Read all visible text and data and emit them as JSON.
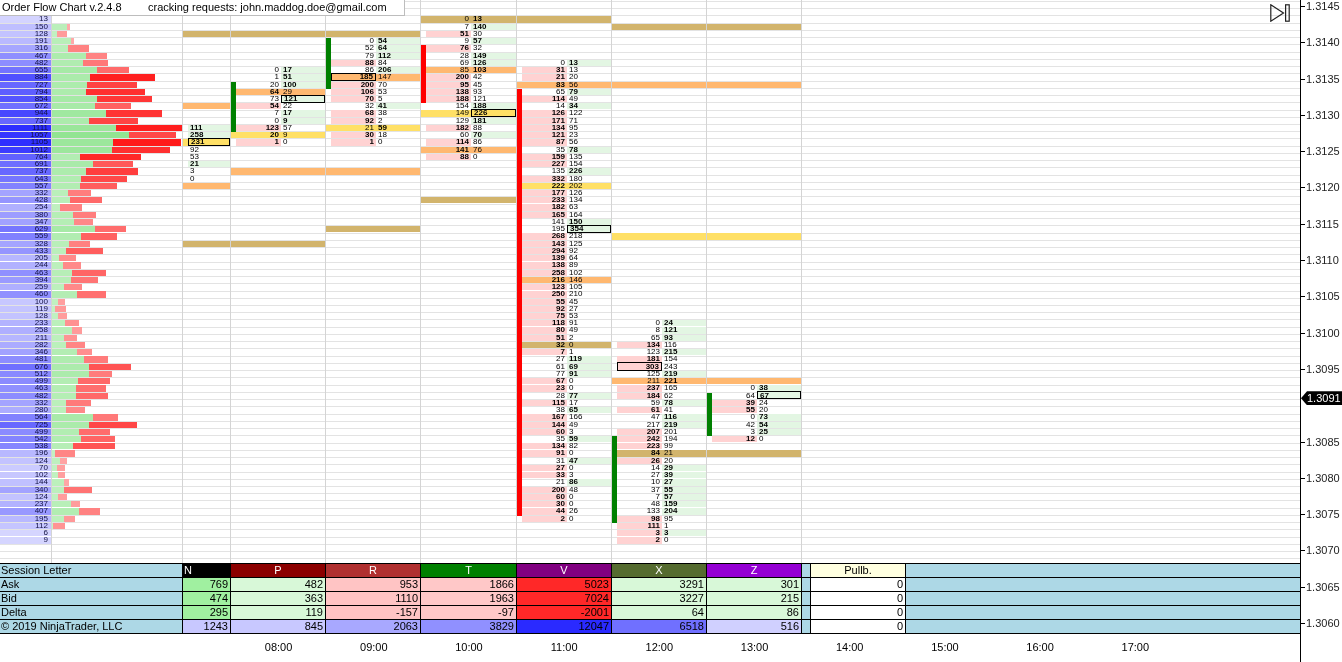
{
  "header": {
    "title": "Order Flow Chart v.2.4.8",
    "note": "cracking requests: john.maddog.doe@gmail.com"
  },
  "profile": [
    {
      "volume": "13"
    },
    {
      "volume": "150",
      "level": 0.87
    },
    {
      "volume": "128",
      "level": 0.35
    },
    {
      "volume": "191",
      "level": 0.85
    },
    {
      "volume": "316",
      "level": 0.44
    },
    {
      "volume": "467",
      "level": 0.63
    },
    {
      "volume": "482",
      "level": 0.55
    },
    {
      "volume": "655",
      "level": 0.59
    },
    {
      "volume": "884",
      "level": 0.37
    },
    {
      "volume": "727",
      "level": 0.41
    },
    {
      "volume": "794",
      "level": 0.37
    },
    {
      "volume": "854",
      "level": 0.45
    },
    {
      "volume": "672",
      "level": 0.55
    },
    {
      "volume": "944",
      "level": 0.49
    },
    {
      "volume": "737",
      "level": 0.43
    },
    {
      "volume": "1111",
      "level": 0.49
    },
    {
      "volume": "1057",
      "level": 0.62
    },
    {
      "volume": "1105",
      "level": 0.47
    },
    {
      "volume": "1012",
      "level": 0.51
    },
    {
      "volume": "764",
      "level": 0.31
    },
    {
      "volume": "691",
      "level": 0.51
    },
    {
      "volume": "737",
      "level": 0.4
    },
    {
      "volume": "643",
      "level": 0.38
    },
    {
      "volume": "557",
      "level": 0.43
    },
    {
      "volume": "332",
      "level": 0.4
    },
    {
      "volume": "428",
      "level": 0.36
    },
    {
      "volume": "254",
      "level": 0.28
    },
    {
      "volume": "380",
      "level": 0.48
    },
    {
      "volume": "347",
      "level": 0.55
    },
    {
      "volume": "629",
      "level": 0.59
    },
    {
      "volume": "559",
      "level": 0.45
    },
    {
      "volume": "328",
      "level": 0.43
    },
    {
      "volume": "433",
      "level": 0.27
    },
    {
      "volume": "205",
      "level": 0.31
    },
    {
      "volume": "244",
      "level": 0.4
    },
    {
      "volume": "463",
      "level": 0.37
    },
    {
      "volume": "394",
      "level": 0.42
    },
    {
      "volume": "259",
      "level": 0.41
    },
    {
      "volume": "460",
      "level": 0.46
    },
    {
      "volume": "100",
      "level": 0.43
    },
    {
      "volume": "119",
      "level": 0.24
    },
    {
      "volume": "128",
      "level": 0.42
    },
    {
      "volume": "233",
      "level": 0.49
    },
    {
      "volume": "258",
      "level": 0.67
    },
    {
      "volume": "211",
      "level": 0.47
    },
    {
      "volume": "282",
      "level": 0.41
    },
    {
      "volume": "346",
      "level": 0.63
    },
    {
      "volume": "481",
      "level": 0.57
    },
    {
      "volume": "676",
      "level": 0.47
    },
    {
      "volume": "512",
      "level": 0.61
    },
    {
      "volume": "499",
      "level": 0.45
    },
    {
      "volume": "463",
      "level": 0.45
    },
    {
      "volume": "482",
      "level": 0.43
    },
    {
      "volume": "332",
      "level": 0.37
    },
    {
      "volume": "280",
      "level": 0.44
    },
    {
      "volume": "564",
      "level": 0.62
    },
    {
      "volume": "725",
      "level": 0.44
    },
    {
      "volume": "499",
      "level": 0.47
    },
    {
      "volume": "542",
      "level": 0.46
    },
    {
      "volume": "538",
      "level": 0.34
    },
    {
      "volume": "196",
      "level": 0.15
    },
    {
      "volume": "124",
      "level": 0.58
    },
    {
      "volume": "70",
      "level": 0.4
    },
    {
      "volume": "102",
      "level": 0.43
    },
    {
      "volume": "144",
      "level": 0.72
    },
    {
      "volume": "340",
      "level": 0.31
    },
    {
      "volume": "124",
      "level": 0.42
    },
    {
      "volume": "237",
      "level": 0.67
    },
    {
      "volume": "407",
      "level": 0.56
    },
    {
      "volume": "195",
      "level": 0.52
    },
    {
      "volume": "112",
      "level": 0.03
    },
    {
      "volume": "6"
    },
    {
      "volume": "9"
    }
  ],
  "footprint": [
    {
      "cells": [
        null,
        null,
        {
          "color": "#d2b46c"
        },
        null,
        null,
        null,
        null,
        null,
        null,
        null,
        null,
        null,
        {
          "color": "#ffb870"
        },
        null,
        null,
        {
          "ask": "111",
          "ask_bold": true,
          "ask_box": false,
          "body": false
        },
        {
          "ask": "258",
          "ask_bold": true,
          "ask_box": false,
          "body": false
        },
        {
          "ask": "231",
          "ask_bold": true,
          "ask_box": true,
          "body": false,
          "color": "#ffe066"
        },
        {
          "ask": "92",
          "ask_bold": false,
          "ask_box": false,
          "body": false
        },
        {
          "ask": "53",
          "ask_bold": false,
          "ask_box": false,
          "body": false
        },
        {
          "ask": "21",
          "ask_bold": true,
          "ask_box": false,
          "body": false
        },
        {
          "ask": "3",
          "ask_bold": false,
          "ask_box": false,
          "body": false
        },
        {
          "ask": "0",
          "ask_bold": false,
          "ask_box": false,
          "body": false
        },
        {
          "color": "#ffb870"
        },
        null,
        null,
        null,
        null,
        null,
        null,
        null,
        {
          "color": "#d2b46c"
        }
      ]
    },
    {
      "rising": true,
      "cells": [
        null,
        null,
        {
          "color": "#d2b46c"
        },
        null,
        null,
        null,
        null,
        {
          "bid": "0",
          "ask": "17",
          "bid_box": false,
          "ask_box": false,
          "body": false
        },
        {
          "bid": "1",
          "ask": "51",
          "bid_box": false,
          "ask_box": false,
          "body": false
        },
        {
          "bid": "20",
          "ask": "100",
          "bid_box": false,
          "ask_box": false,
          "body": true
        },
        {
          "bid": "64",
          "ask": "29",
          "bid_box": false,
          "ask_box": false,
          "body": true,
          "color": "#ffb870"
        },
        {
          "bid": "73",
          "ask": "121",
          "bid_box": false,
          "ask_box": true,
          "body": true
        },
        {
          "bid": "54",
          "ask": "22",
          "bid_box": false,
          "ask_box": false,
          "body": true
        },
        {
          "bid": "7",
          "ask": "17",
          "bid_box": false,
          "ask_box": false,
          "body": true
        },
        {
          "bid": "0",
          "ask": "9",
          "bid_box": false,
          "ask_box": false,
          "body": true
        },
        {
          "bid": "123",
          "ask": "57",
          "bid_box": false,
          "ask_box": false,
          "body": true
        },
        {
          "bid": "20",
          "ask": "9",
          "bid_box": false,
          "ask_box": false,
          "body": false,
          "color": "#ffe066"
        },
        {
          "bid": "1",
          "ask": "0",
          "bid_box": false,
          "ask_box": false,
          "body": false
        },
        null,
        null,
        null,
        {
          "color": "#ffb870"
        },
        null,
        null,
        null,
        null,
        null,
        null,
        null,
        null,
        null,
        {
          "color": "#d2b46c"
        }
      ]
    },
    {
      "rising": true,
      "cells": [
        null,
        null,
        {
          "color": "#d2b46c"
        },
        {
          "bid": "0",
          "ask": "54",
          "bid_box": false,
          "ask_box": false,
          "body": true
        },
        {
          "bid": "52",
          "ask": "64",
          "bid_box": false,
          "ask_box": false,
          "body": true
        },
        {
          "bid": "79",
          "ask": "112",
          "bid_box": false,
          "ask_box": false,
          "body": true
        },
        {
          "bid": "88",
          "ask": "84",
          "bid_box": false,
          "ask_box": false,
          "body": true
        },
        {
          "bid": "86",
          "ask": "206",
          "bid_box": false,
          "ask_box": false,
          "body": true
        },
        {
          "bid": "185",
          "ask": "147",
          "bid_box": true,
          "ask_box": false,
          "body": true,
          "color": "#ffb870"
        },
        {
          "bid": "200",
          "ask": "70",
          "bid_box": false,
          "ask_box": false,
          "body": true
        },
        {
          "bid": "106",
          "ask": "53",
          "bid_box": false,
          "ask_box": false,
          "body": false
        },
        {
          "bid": "70",
          "ask": "5",
          "bid_box": false,
          "ask_box": false,
          "body": false
        },
        {
          "bid": "32",
          "ask": "41",
          "bid_box": false,
          "ask_box": false,
          "body": false
        },
        {
          "bid": "68",
          "ask": "38",
          "bid_box": false,
          "ask_box": false,
          "body": false
        },
        {
          "bid": "92",
          "ask": "2",
          "bid_box": false,
          "ask_box": false,
          "body": false
        },
        {
          "bid": "21",
          "ask": "59",
          "bid_box": false,
          "ask_box": false,
          "body": false,
          "color": "#ffe066"
        },
        {
          "bid": "30",
          "ask": "18",
          "bid_box": false,
          "ask_box": false,
          "body": false
        },
        {
          "bid": "1",
          "ask": "0",
          "bid_box": false,
          "ask_box": false,
          "body": false
        },
        null,
        null,
        null,
        {
          "color": "#ffb870"
        },
        null,
        null,
        null,
        null,
        null,
        null,
        null,
        {
          "color": "#d2b46c"
        }
      ]
    },
    {
      "rising": false,
      "cells": [
        {
          "bid": "0",
          "ask": "13",
          "bid_box": false,
          "ask_box": false,
          "body": false,
          "color": "#d2b46c"
        },
        {
          "bid": "7",
          "ask": "140",
          "bid_box": false,
          "ask_box": false,
          "body": false
        },
        {
          "bid": "51",
          "ask": "30",
          "bid_box": false,
          "ask_box": false,
          "body": false
        },
        {
          "bid": "9",
          "ask": "57",
          "bid_box": false,
          "ask_box": false,
          "body": false
        },
        {
          "bid": "76",
          "ask": "32",
          "bid_box": false,
          "ask_box": false,
          "body": true
        },
        {
          "bid": "28",
          "ask": "149",
          "bid_box": false,
          "ask_box": false,
          "body": true
        },
        {
          "bid": "69",
          "ask": "126",
          "bid_box": false,
          "ask_box": false,
          "body": true
        },
        {
          "bid": "85",
          "ask": "103",
          "bid_box": false,
          "ask_box": false,
          "body": true,
          "color": "#ffb870"
        },
        {
          "bid": "200",
          "ask": "42",
          "bid_box": false,
          "ask_box": false,
          "body": true
        },
        {
          "bid": "95",
          "ask": "45",
          "bid_box": false,
          "ask_box": false,
          "body": true
        },
        {
          "bid": "138",
          "ask": "93",
          "bid_box": false,
          "ask_box": false,
          "body": true
        },
        {
          "bid": "188",
          "ask": "121",
          "bid_box": false,
          "ask_box": false,
          "body": true
        },
        {
          "bid": "154",
          "ask": "188",
          "bid_box": false,
          "ask_box": false,
          "body": false
        },
        {
          "bid": "149",
          "ask": "226",
          "bid_box": false,
          "ask_box": true,
          "body": false,
          "color": "#ffe066"
        },
        {
          "bid": "129",
          "ask": "181",
          "bid_box": false,
          "ask_box": false,
          "body": false
        },
        {
          "bid": "182",
          "ask": "88",
          "bid_box": false,
          "ask_box": false,
          "body": false
        },
        {
          "bid": "60",
          "ask": "70",
          "bid_box": false,
          "ask_box": false,
          "body": false
        },
        {
          "bid": "114",
          "ask": "86",
          "bid_box": false,
          "ask_box": false,
          "body": false
        },
        {
          "bid": "141",
          "ask": "76",
          "bid_box": false,
          "ask_box": false,
          "body": false,
          "color": "#ffb870"
        },
        {
          "bid": "88",
          "ask": "0",
          "bid_box": false,
          "ask_box": false,
          "body": false
        },
        null,
        null,
        null,
        null,
        null,
        {
          "color": "#d2b46c"
        }
      ]
    },
    {
      "rising": false,
      "cells": [
        {
          "color": "#d2b46c"
        },
        null,
        null,
        null,
        null,
        null,
        {
          "bid": "0",
          "ask": "13",
          "bid_box": false,
          "ask_box": false,
          "body": false
        },
        {
          "bid": "31",
          "ask": "13",
          "bid_box": false,
          "ask_box": false,
          "body": false
        },
        {
          "bid": "21",
          "ask": "20",
          "bid_box": false,
          "ask_box": false,
          "body": false
        },
        {
          "bid": "83",
          "ask": "56",
          "bid_box": false,
          "ask_box": false,
          "body": false,
          "color": "#ffb870"
        },
        {
          "bid": "65",
          "ask": "79",
          "bid_box": false,
          "ask_box": false,
          "body": true
        },
        {
          "bid": "114",
          "ask": "49",
          "bid_box": false,
          "ask_box": false,
          "body": true
        },
        {
          "bid": "14",
          "ask": "34",
          "bid_box": false,
          "ask_box": false,
          "body": true
        },
        {
          "bid": "126",
          "ask": "122",
          "bid_box": false,
          "ask_box": false,
          "body": true
        },
        {
          "bid": "171",
          "ask": "71",
          "bid_box": false,
          "ask_box": false,
          "body": true
        },
        {
          "bid": "134",
          "ask": "95",
          "bid_box": false,
          "ask_box": false,
          "body": true
        },
        {
          "bid": "121",
          "ask": "23",
          "bid_box": false,
          "ask_box": false,
          "body": true
        },
        {
          "bid": "87",
          "ask": "56",
          "bid_box": false,
          "ask_box": false,
          "body": true
        },
        {
          "bid": "35",
          "ask": "78",
          "bid_box": false,
          "ask_box": false,
          "body": true
        },
        {
          "bid": "159",
          "ask": "135",
          "bid_box": false,
          "ask_box": false,
          "body": true
        },
        {
          "bid": "227",
          "ask": "154",
          "bid_box": false,
          "ask_box": false,
          "body": true
        },
        {
          "bid": "135",
          "ask": "226",
          "bid_box": false,
          "ask_box": false,
          "body": true
        },
        {
          "bid": "332",
          "ask": "180",
          "bid_box": false,
          "ask_box": false,
          "body": true
        },
        {
          "bid": "222",
          "ask": "202",
          "bid_box": false,
          "ask_box": false,
          "body": true,
          "color": "#ffe066"
        },
        {
          "bid": "177",
          "ask": "126",
          "bid_box": false,
          "ask_box": false,
          "body": true
        },
        {
          "bid": "233",
          "ask": "134",
          "bid_box": false,
          "ask_box": false,
          "body": true
        },
        {
          "bid": "182",
          "ask": "63",
          "bid_box": false,
          "ask_box": false,
          "body": true
        },
        {
          "bid": "165",
          "ask": "164",
          "bid_box": false,
          "ask_box": false,
          "body": true
        },
        {
          "bid": "141",
          "ask": "150",
          "bid_box": false,
          "ask_box": false,
          "body": true
        },
        {
          "bid": "195",
          "ask": "354",
          "bid_box": false,
          "ask_box": true,
          "body": true
        },
        {
          "bid": "268",
          "ask": "218",
          "bid_box": false,
          "ask_box": false,
          "body": true
        },
        {
          "bid": "143",
          "ask": "125",
          "bid_box": false,
          "ask_box": false,
          "body": true
        },
        {
          "bid": "294",
          "ask": "92",
          "bid_box": false,
          "ask_box": false,
          "body": true
        },
        {
          "bid": "139",
          "ask": "64",
          "bid_box": false,
          "ask_box": false,
          "body": true
        },
        {
          "bid": "138",
          "ask": "89",
          "bid_box": false,
          "ask_box": false,
          "body": true
        },
        {
          "bid": "258",
          "ask": "102",
          "bid_box": false,
          "ask_box": false,
          "body": true
        },
        {
          "bid": "216",
          "ask": "146",
          "bid_box": false,
          "ask_box": false,
          "body": true,
          "color": "#ffb870"
        },
        {
          "bid": "123",
          "ask": "105",
          "bid_box": false,
          "ask_box": false,
          "body": true
        },
        {
          "bid": "250",
          "ask": "210",
          "bid_box": false,
          "ask_box": false,
          "body": true
        },
        {
          "bid": "55",
          "ask": "45",
          "bid_box": false,
          "ask_box": false,
          "body": true
        },
        {
          "bid": "92",
          "ask": "27",
          "bid_box": false,
          "ask_box": false,
          "body": true
        },
        {
          "bid": "75",
          "ask": "53",
          "bid_box": false,
          "ask_box": false,
          "body": true
        },
        {
          "bid": "118",
          "ask": "91",
          "bid_box": false,
          "ask_box": false,
          "body": true
        },
        {
          "bid": "80",
          "ask": "49",
          "bid_box": false,
          "ask_box": false,
          "body": true
        },
        {
          "bid": "51",
          "ask": "2",
          "bid_box": false,
          "ask_box": false,
          "body": true
        },
        {
          "bid": "32",
          "ask": "0",
          "bid_box": false,
          "ask_box": false,
          "body": true,
          "color": "#d2b46c"
        },
        {
          "bid": "7",
          "ask": "1",
          "bid_box": false,
          "ask_box": false,
          "body": true
        },
        {
          "bid": "27",
          "ask": "119",
          "bid_box": false,
          "ask_box": false,
          "body": true
        },
        {
          "bid": "61",
          "ask": "69",
          "bid_box": false,
          "ask_box": false,
          "body": true
        },
        {
          "bid": "77",
          "ask": "91",
          "bid_box": false,
          "ask_box": false,
          "body": true
        },
        {
          "bid": "67",
          "ask": "0",
          "bid_box": false,
          "ask_box": false,
          "body": true
        },
        {
          "bid": "23",
          "ask": "0",
          "bid_box": false,
          "ask_box": false,
          "body": true
        },
        {
          "bid": "28",
          "ask": "77",
          "bid_box": false,
          "ask_box": false,
          "body": true
        },
        {
          "bid": "115",
          "ask": "17",
          "bid_box": false,
          "ask_box": false,
          "body": true
        },
        {
          "bid": "38",
          "ask": "65",
          "bid_box": false,
          "ask_box": false,
          "body": true
        },
        {
          "bid": "167",
          "ask": "166",
          "bid_box": false,
          "ask_box": false,
          "body": true
        },
        {
          "bid": "144",
          "ask": "49",
          "bid_box": false,
          "ask_box": false,
          "body": true
        },
        {
          "bid": "60",
          "ask": "3",
          "bid_box": false,
          "ask_box": false,
          "body": true
        },
        {
          "bid": "35",
          "ask": "59",
          "bid_box": false,
          "ask_box": false,
          "body": true
        },
        {
          "bid": "134",
          "ask": "82",
          "bid_box": false,
          "ask_box": false,
          "body": true
        },
        {
          "bid": "91",
          "ask": "0",
          "bid_box": false,
          "ask_box": false,
          "body": true
        },
        {
          "bid": "31",
          "ask": "47",
          "bid_box": false,
          "ask_box": false,
          "body": true
        },
        {
          "bid": "27",
          "ask": "0",
          "bid_box": false,
          "ask_box": false,
          "body": true
        },
        {
          "bid": "33",
          "ask": "3",
          "bid_box": false,
          "ask_box": false,
          "body": true
        },
        {
          "bid": "21",
          "ask": "86",
          "bid_box": false,
          "ask_box": false,
          "body": true
        },
        {
          "bid": "200",
          "ask": "48",
          "bid_box": false,
          "ask_box": false,
          "body": true
        },
        {
          "bid": "60",
          "ask": "0",
          "bid_box": false,
          "ask_box": false,
          "body": true
        },
        {
          "bid": "30",
          "ask": "0",
          "bid_box": false,
          "ask_box": false,
          "body": true
        },
        {
          "bid": "44",
          "ask": "26",
          "bid_box": false,
          "ask_box": false,
          "body": true
        },
        {
          "bid": "2",
          "ask": "0",
          "bid_box": false,
          "ask_box": false,
          "body": false
        }
      ]
    },
    {
      "rising": true,
      "cells": [
        null,
        {
          "color": "#d2b46c"
        },
        null,
        null,
        null,
        null,
        null,
        null,
        null,
        {
          "color": "#ffb870"
        },
        null,
        null,
        null,
        null,
        null,
        null,
        null,
        null,
        null,
        null,
        null,
        null,
        null,
        null,
        null,
        null,
        null,
        null,
        null,
        null,
        {
          "color": "#ffe066"
        },
        null,
        null,
        null,
        null,
        null,
        null,
        null,
        null,
        null,
        null,
        null,
        {
          "bid": "0",
          "ask": "24",
          "bid_box": false,
          "ask_box": false,
          "body": false
        },
        {
          "bid": "8",
          "ask": "121",
          "bid_box": false,
          "ask_box": false,
          "body": false
        },
        {
          "bid": "65",
          "ask": "93",
          "bid_box": false,
          "ask_box": false,
          "body": false
        },
        {
          "bid": "134",
          "ask": "116",
          "bid_box": false,
          "ask_box": false,
          "body": false
        },
        {
          "bid": "123",
          "ask": "215",
          "bid_box": false,
          "ask_box": false,
          "body": false
        },
        {
          "bid": "181",
          "ask": "154",
          "bid_box": false,
          "ask_box": false,
          "body": false
        },
        {
          "bid": "303",
          "ask": "243",
          "bid_box": true,
          "ask_box": false,
          "body": false
        },
        {
          "bid": "125",
          "ask": "219",
          "bid_box": false,
          "ask_box": false,
          "body": false
        },
        {
          "bid": "211",
          "ask": "221",
          "bid_box": false,
          "ask_box": false,
          "body": false,
          "color": "#ffb870"
        },
        {
          "bid": "237",
          "ask": "165",
          "bid_box": false,
          "ask_box": false,
          "body": false
        },
        {
          "bid": "184",
          "ask": "62",
          "bid_box": false,
          "ask_box": false,
          "body": false
        },
        {
          "bid": "59",
          "ask": "78",
          "bid_box": false,
          "ask_box": false,
          "body": false
        },
        {
          "bid": "61",
          "ask": "41",
          "bid_box": false,
          "ask_box": false,
          "body": false
        },
        {
          "bid": "47",
          "ask": "116",
          "bid_box": false,
          "ask_box": false,
          "body": false
        },
        {
          "bid": "217",
          "ask": "219",
          "bid_box": false,
          "ask_box": false,
          "body": false
        },
        {
          "bid": "207",
          "ask": "201",
          "bid_box": false,
          "ask_box": false,
          "body": false
        },
        {
          "bid": "242",
          "ask": "194",
          "bid_box": false,
          "ask_box": false,
          "body": true
        },
        {
          "bid": "223",
          "ask": "99",
          "bid_box": false,
          "ask_box": false,
          "body": true
        },
        {
          "bid": "84",
          "ask": "21",
          "bid_box": false,
          "ask_box": false,
          "body": true,
          "color": "#d2b46c"
        },
        {
          "bid": "26",
          "ask": "20",
          "bid_box": false,
          "ask_box": false,
          "body": true
        },
        {
          "bid": "14",
          "ask": "29",
          "bid_box": false,
          "ask_box": false,
          "body": true
        },
        {
          "bid": "27",
          "ask": "39",
          "bid_box": false,
          "ask_box": false,
          "body": true
        },
        {
          "bid": "10",
          "ask": "27",
          "bid_box": false,
          "ask_box": false,
          "body": true
        },
        {
          "bid": "37",
          "ask": "55",
          "bid_box": false,
          "ask_box": false,
          "body": true
        },
        {
          "bid": "7",
          "ask": "57",
          "bid_box": false,
          "ask_box": false,
          "body": true
        },
        {
          "bid": "48",
          "ask": "159",
          "bid_box": false,
          "ask_box": false,
          "body": true
        },
        {
          "bid": "133",
          "ask": "204",
          "bid_box": false,
          "ask_box": false,
          "body": true
        },
        {
          "bid": "98",
          "ask": "95",
          "bid_box": false,
          "ask_box": false,
          "body": true
        },
        {
          "bid": "111",
          "ask": "1",
          "bid_box": false,
          "ask_box": false,
          "body": false
        },
        {
          "bid": "3",
          "ask": "3",
          "bid_box": false,
          "ask_box": false,
          "body": false
        },
        {
          "bid": "2",
          "ask": "0",
          "bid_box": false,
          "ask_box": false,
          "body": false
        }
      ]
    },
    {
      "rising": true,
      "cells": [
        null,
        {
          "color": "#d2b46c"
        },
        null,
        null,
        null,
        null,
        null,
        null,
        null,
        {
          "color": "#ffb870"
        },
        null,
        null,
        null,
        null,
        null,
        null,
        null,
        null,
        null,
        null,
        null,
        null,
        null,
        null,
        null,
        null,
        null,
        null,
        null,
        null,
        {
          "color": "#ffe066"
        },
        null,
        null,
        null,
        null,
        null,
        null,
        null,
        null,
        null,
        null,
        null,
        null,
        null,
        null,
        null,
        null,
        null,
        null,
        null,
        {
          "color": "#ffb870"
        },
        {
          "bid": "0",
          "ask": "38",
          "bid_box": false,
          "ask_box": false,
          "body": false
        },
        {
          "bid": "64",
          "ask": "67",
          "bid_box": false,
          "ask_box": true,
          "body": true
        },
        {
          "bid": "39",
          "ask": "24",
          "bid_box": false,
          "ask_box": false,
          "body": true
        },
        {
          "bid": "55",
          "ask": "20",
          "bid_box": false,
          "ask_box": false,
          "body": true
        },
        {
          "bid": "0",
          "ask": "73",
          "bid_box": false,
          "ask_box": false,
          "body": true
        },
        {
          "bid": "42",
          "ask": "54",
          "bid_box": false,
          "ask_box": false,
          "body": true
        },
        {
          "bid": "3",
          "ask": "25",
          "bid_box": false,
          "ask_box": false,
          "body": true
        },
        {
          "bid": "12",
          "ask": "0",
          "bid_box": false,
          "ask_box": false,
          "body": false
        },
        null,
        {
          "color": "#d2b46c"
        }
      ]
    }
  ],
  "price_axis": [
    {
      "text": "1.3145",
      "kind": "price"
    },
    {
      "text": "1.3140",
      "kind": "price"
    },
    {
      "text": "1.3135",
      "kind": "price"
    },
    {
      "text": "1.3130",
      "kind": "price"
    },
    {
      "text": "1.3125",
      "kind": "price"
    },
    {
      "text": "1.3120",
      "kind": "price"
    },
    {
      "text": "1.3115",
      "kind": "price"
    },
    {
      "text": "1.3110",
      "kind": "price"
    },
    {
      "text": "1.3105",
      "kind": "price"
    },
    {
      "text": "1.3100",
      "kind": "price"
    },
    {
      "text": "1.3095",
      "kind": "price"
    },
    {
      "text": "1.3091",
      "kind": "current"
    },
    {
      "text": "1.3085",
      "kind": "price"
    },
    {
      "text": "1.3080",
      "kind": "price"
    },
    {
      "text": "1.3075",
      "kind": "price"
    },
    {
      "text": "1.3070",
      "kind": "price"
    },
    {
      "text": "1.3065",
      "kind": "price"
    },
    {
      "text": "1.3060",
      "kind": "price"
    }
  ],
  "session_table": {
    "rows": [
      {
        "label": "Session Letter",
        "cells": [
          {
            "text": "N",
            "color": "#000000"
          },
          {
            "text": "P",
            "color": "#8b0000"
          },
          {
            "text": "R",
            "color": "#b03030"
          },
          {
            "text": "T",
            "color": "#008000"
          },
          {
            "text": "V",
            "color": "#800080"
          },
          {
            "text": "X",
            "color": "#556b2f"
          },
          {
            "text": "Z",
            "color": "#9400d3"
          }
        ],
        "pullback": "Pullb."
      },
      {
        "label": "Ask",
        "cells": [
          {
            "text": "769",
            "color": "#a0f0a0"
          },
          {
            "text": "482",
            "color": "#d8f8d8"
          },
          {
            "text": "953",
            "color": "#ffc4c4"
          },
          {
            "text": "1866",
            "color": "#ffc8c8"
          },
          {
            "text": "5023",
            "color": "#ff2828"
          },
          {
            "text": "3291",
            "color": "#d8f8d8"
          },
          {
            "text": "301",
            "color": "#d8f8d8"
          }
        ],
        "pullback": "0"
      },
      {
        "label": "Bid",
        "cells": [
          {
            "text": "474",
            "color": "#a0f0a0"
          },
          {
            "text": "363",
            "color": "#d8f8d8"
          },
          {
            "text": "1110",
            "color": "#ffc4c4"
          },
          {
            "text": "1963",
            "color": "#ffc8c8"
          },
          {
            "text": "7024",
            "color": "#ff2828"
          },
          {
            "text": "3227",
            "color": "#d8f8d8"
          },
          {
            "text": "215",
            "color": "#d8f8d8"
          }
        ],
        "pullback": "0"
      },
      {
        "label": "Delta",
        "cells": [
          {
            "text": "295",
            "color": "#a0f0a0"
          },
          {
            "text": "119",
            "color": "#d8f8d8"
          },
          {
            "text": "-157",
            "color": "#ffc4c4"
          },
          {
            "text": "-97",
            "color": "#ffc8c8"
          },
          {
            "text": "-2001",
            "color": "#ff2828"
          },
          {
            "text": "64",
            "color": "#d8f8d8"
          },
          {
            "text": "86",
            "color": "#d8f8d8"
          }
        ],
        "pullback": "0"
      },
      {
        "label": "© 2019 NinjaTrader, LLC",
        "cells": [
          {
            "text": "1243",
            "color": "#c8c8ff"
          },
          {
            "text": "845",
            "color": "#c8c8ff"
          },
          {
            "text": "2063",
            "color": "#a8a8ff"
          },
          {
            "text": "3829",
            "color": "#9090ff"
          },
          {
            "text": "12047",
            "color": "#2a2aff"
          },
          {
            "text": "6518",
            "color": "#7070ff"
          },
          {
            "text": "516",
            "color": "#d0d0ff"
          }
        ],
        "pullback": "0"
      }
    ]
  },
  "time_axis": [
    "08:00",
    "09:00",
    "10:00",
    "11:00",
    "12:00",
    "13:00",
    "14:00",
    "15:00",
    "16:00",
    "17:00"
  ]
}
